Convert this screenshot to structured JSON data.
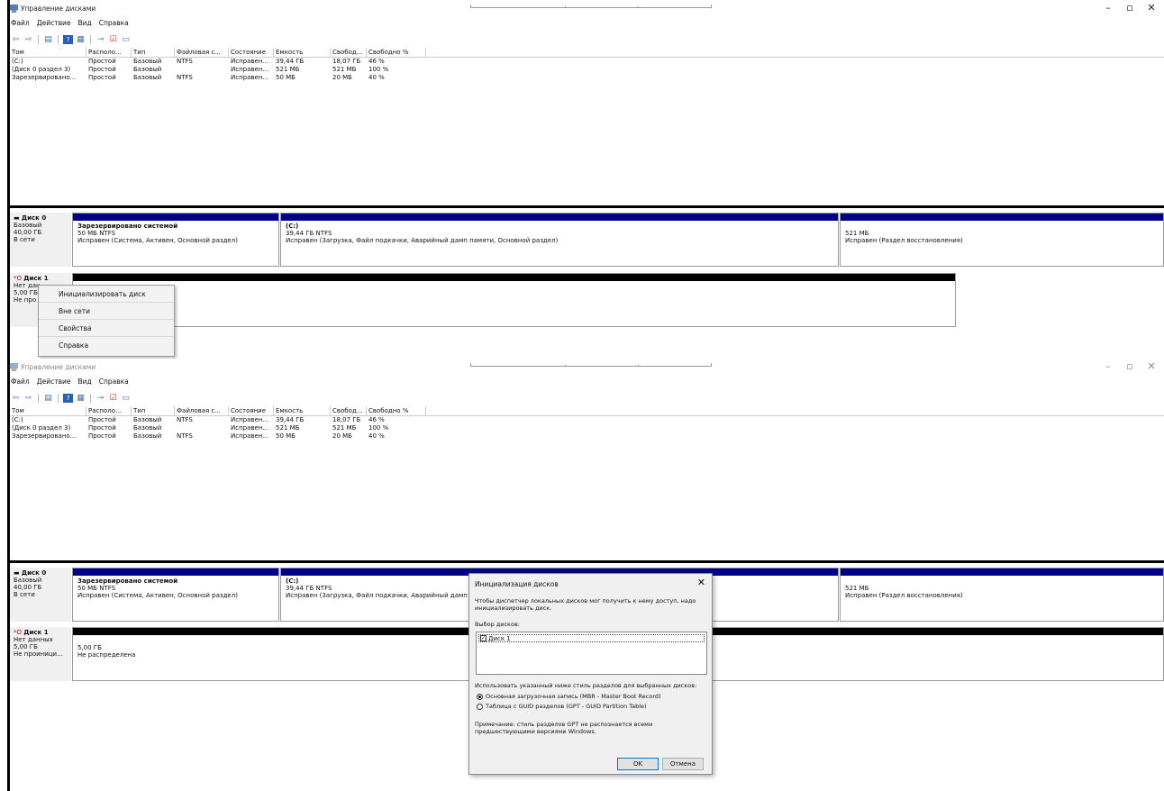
{
  "app": {
    "title": "Управление дисками",
    "menu": [
      "Файл",
      "Действие",
      "Вид",
      "Справка"
    ],
    "window_controls": {
      "minimize": "–",
      "maximize": "▫",
      "close": "✕"
    }
  },
  "toolbar_icons": [
    "back-arrow-icon",
    "forward-arrow-icon",
    "list-icon",
    "help-icon",
    "view-icon",
    "connect-icon",
    "check-icon",
    "console-icon"
  ],
  "volume_list": {
    "columns": [
      "Том",
      "Располо...",
      "Тип",
      "Файловая с...",
      "Состояние",
      "Емкость",
      "Свобод...",
      "Свободно %"
    ],
    "rows": [
      [
        "(C:)",
        "Простой",
        "Базовый",
        "NTFS",
        "Исправен...",
        "39,44 ГБ",
        "18,07 ГБ",
        "46 %"
      ],
      [
        "(Диск 0 раздел 3)",
        "Простой",
        "Базовый",
        "",
        "Исправен...",
        "521 МБ",
        "521 МБ",
        "100 %"
      ],
      [
        "Зарезервировано...",
        "Простой",
        "Базовый",
        "NTFS",
        "Исправен...",
        "50 МБ",
        "20 МБ",
        "40 %"
      ]
    ]
  },
  "disk0": {
    "name": "Диск 0",
    "type": "Базовый",
    "size": "40,00 ГБ",
    "status": "В сети",
    "partitions": [
      {
        "name": "Зарезервировано системой",
        "size": "50 МБ NTFS",
        "status": "Исправен (Система, Активен, Основной раздел)"
      },
      {
        "name": "(C:)",
        "size": "39,44 ГБ NTFS",
        "status": "Исправен (Загрузка, Файл подкачки, Аварийный дамп памяти, Основной раздел)"
      },
      {
        "name": "",
        "size": "521 МБ",
        "status": "Исправен (Раздел восстановления)"
      }
    ]
  },
  "disk1_top": {
    "name": "Диск 1",
    "type": "Нет дан",
    "size": "5,00 ГБ",
    "status": "Не про"
  },
  "disk1_bottom": {
    "name": "Диск 1",
    "type": "Нет данных",
    "size": "5,00 ГБ",
    "status": "Не проиници...",
    "part_size": "5,00 ГБ",
    "part_status": "Не распределена"
  },
  "context_menu": [
    "Инициализировать диск",
    "Вне сети",
    "Свойства",
    "Справка"
  ],
  "dialog": {
    "title": "Инициализация дисков",
    "close": "✕",
    "intro": "Чтобы диспетчер локальных дисков мог получить к нему доступ, надо инициализировать диск.",
    "select_label": "Выбор дисков:",
    "disk_item": "Диск 1",
    "style_label": "Использовать указанный ниже стиль разделов для выбранных дисков:",
    "option_mbr": "Основная загрузочная запись (MBR - Master Boot Record)",
    "option_gpt": "Таблица с GUID разделов (GPT - GUID Partition Table)",
    "note": "Примечание: стиль разделов GPT не распознается всеми предшествующими версиями Windows.",
    "ok": "OK",
    "cancel": "Отмена"
  }
}
